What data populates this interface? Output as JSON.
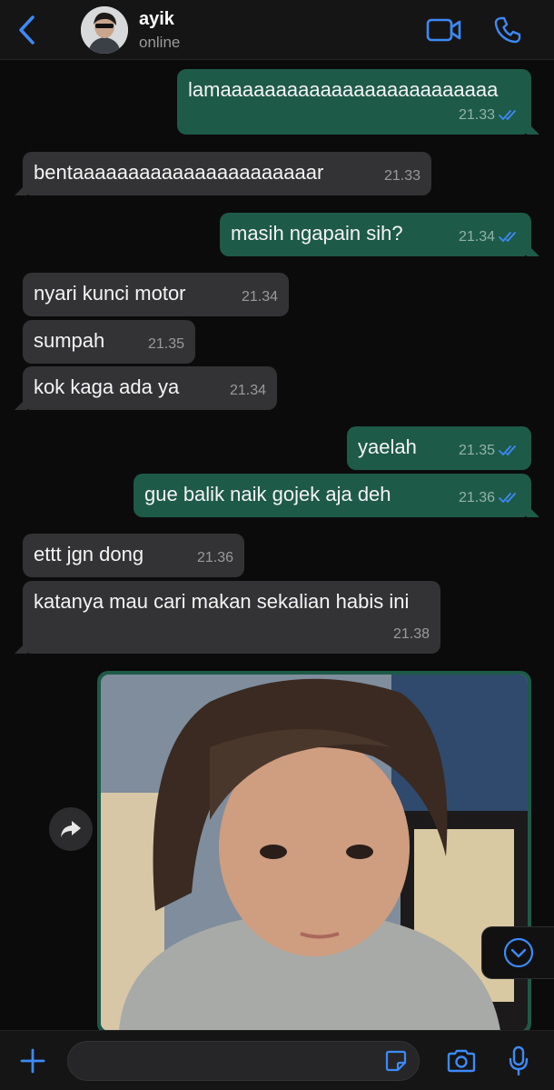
{
  "header": {
    "back_icon": "chevron-left-icon",
    "contact_name": "ayik",
    "contact_status": "online",
    "video_icon": "video-camera-icon",
    "call_icon": "phone-icon",
    "accent_color": "#3d8af7"
  },
  "messages": [
    {
      "dir": "out",
      "text": "lamaaaaaaaaaaaaaaaaaaaaaaaaa",
      "time": "21.33",
      "read": true
    },
    {
      "dir": "in",
      "text": "bentaaaaaaaaaaaaaaaaaaaaaar",
      "time": "21.33"
    },
    {
      "dir": "out",
      "text": "masih ngapain sih?",
      "time": "21.34",
      "read": true
    },
    {
      "dir": "in",
      "text": "nyari kunci motor",
      "time": "21.34"
    },
    {
      "dir": "in",
      "text": "sumpah",
      "time": "21.35"
    },
    {
      "dir": "in",
      "text": "kok kaga ada ya",
      "time": "21.34"
    },
    {
      "dir": "out",
      "text": "yaelah",
      "time": "21.35",
      "read": true
    },
    {
      "dir": "out",
      "text": "gue balik naik gojek aja deh",
      "time": "21.36",
      "read": true
    },
    {
      "dir": "in",
      "text": "ettt jgn dong",
      "time": "21.36"
    },
    {
      "dir": "in",
      "text": "katanya mau cari makan sekalian habis ini",
      "time": "21.38"
    }
  ],
  "photo_message": {
    "dir": "out",
    "type": "photo"
  },
  "forward_icon": "forward-arrow-icon",
  "scroll_down_icon": "chevron-down-circle-icon",
  "input_bar": {
    "add_icon": "plus-icon",
    "placeholder": "",
    "sticker_icon": "sticker-icon",
    "camera_icon": "camera-icon",
    "mic_icon": "microphone-icon"
  },
  "colors": {
    "outgoing_bubble": "#1e5a48",
    "incoming_bubble": "#333335",
    "read_ticks": "#3d8af7"
  }
}
